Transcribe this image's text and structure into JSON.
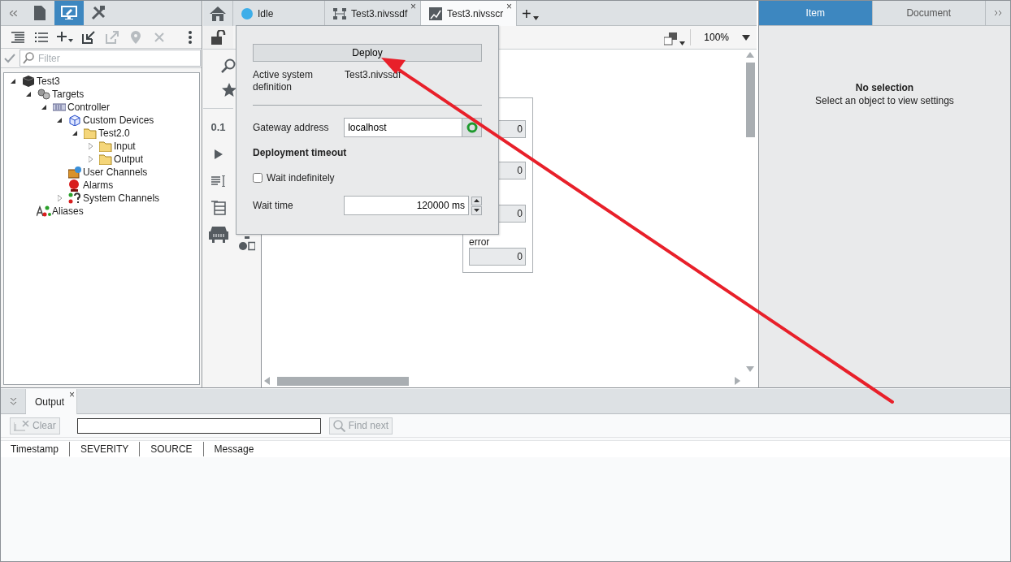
{
  "left_panel": {
    "tabs": [
      {
        "kind": "collapse",
        "selected": false
      },
      {
        "kind": "document",
        "selected": false
      },
      {
        "kind": "monitor",
        "selected": true
      },
      {
        "kind": "tools",
        "selected": false
      }
    ],
    "toolbar": [
      {
        "kind": "outline",
        "disabled": false
      },
      {
        "kind": "bullets",
        "disabled": false
      },
      {
        "kind": "add",
        "disabled": false
      },
      {
        "kind": "import",
        "disabled": false
      },
      {
        "kind": "export",
        "disabled": true
      },
      {
        "kind": "pin",
        "disabled": true
      },
      {
        "kind": "delete",
        "disabled": true
      },
      {
        "kind": "more",
        "disabled": false
      }
    ],
    "filter": {
      "placeholder": "Filter"
    },
    "tree": [
      {
        "label": "Test3",
        "kind": "cube",
        "expanded": true,
        "children": [
          {
            "label": "Targets",
            "kind": "gears",
            "expanded": true,
            "children": [
              {
                "label": "Controller",
                "kind": "controller",
                "expanded": true,
                "children": [
                  {
                    "label": "Custom Devices",
                    "kind": "box",
                    "expanded": true,
                    "children": [
                      {
                        "label": "Test2.0",
                        "kind": "folder",
                        "expanded": true,
                        "children": [
                          {
                            "label": "Input",
                            "kind": "folder",
                            "expanded": false
                          },
                          {
                            "label": "Output",
                            "kind": "folder",
                            "expanded": false
                          }
                        ]
                      }
                    ]
                  },
                  {
                    "label": "User Channels",
                    "kind": "channels"
                  },
                  {
                    "label": "Alarms",
                    "kind": "alarm"
                  },
                  {
                    "label": "System Channels",
                    "kind": "system",
                    "expanded": false
                  }
                ]
              }
            ]
          },
          {
            "label": "Aliases",
            "kind": "aliases"
          }
        ]
      }
    ]
  },
  "document_tabs": [
    {
      "kind": "status",
      "label": "Idle",
      "color": "#3daee9",
      "selected": false
    },
    {
      "kind": "definition",
      "label": "Test3.nivssdf",
      "close": "×",
      "selected": false
    },
    {
      "kind": "screen",
      "label": "Test3.nivsscr",
      "close": "×",
      "selected": true
    }
  ],
  "new_tab_button": "+",
  "editor": {
    "zoom": "100%",
    "palette": [
      {
        "kind": "numeric",
        "label": "0.1"
      },
      {
        "kind": "play"
      },
      {
        "kind": "text"
      },
      {
        "kind": "table"
      },
      {
        "kind": "vehicle"
      }
    ],
    "canvas": {
      "fields": [
        "0",
        "0",
        "0",
        "0"
      ],
      "label": "error"
    }
  },
  "deploy_popup": {
    "button": "Deploy",
    "active_label": "Active system definition",
    "active_value": "Test3.nivssdf",
    "gateway_label": "Gateway address",
    "gateway_value": "localhost",
    "connected": true,
    "timeout_heading": "Deployment timeout",
    "wait_indefinitely": {
      "label": "Wait indefinitely",
      "checked": false
    },
    "wait_label": "Wait time",
    "wait_value": "120000 ms"
  },
  "right_panel": {
    "tabs": [
      {
        "label": "Item",
        "selected": true
      },
      {
        "label": "Document",
        "selected": false
      }
    ],
    "title": "No selection",
    "hint": "Select an object to view settings"
  },
  "output_panel": {
    "tab": {
      "label": "Output",
      "close": "×"
    },
    "clear_button": {
      "label": "Clear",
      "disabled": true
    },
    "find_button": {
      "label": "Find next",
      "disabled": true
    },
    "columns": [
      "Timestamp",
      "SEVERITY",
      "SOURCE",
      "Message"
    ]
  }
}
